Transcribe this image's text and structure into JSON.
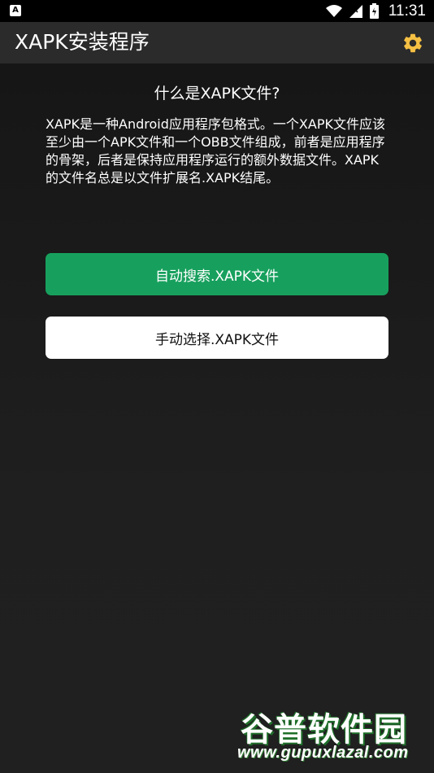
{
  "status_bar": {
    "left_icon": "A",
    "time": "11:31",
    "icons": [
      "wifi-icon",
      "signal-icon",
      "battery-icon"
    ]
  },
  "app_bar": {
    "title": "XAPK安装程序",
    "settings_icon": "gear-icon",
    "accent_color": "#f5c043"
  },
  "main": {
    "heading": "什么是XAPK文件?",
    "description": "XAPK是一种Android应用程序包格式。一个XAPK文件应该至少由一个APK文件和一个OBB文件组成，前者是应用程序的骨架，后者是保持应用程序运行的额外数据文件。XAPK的文件名总是以文件扩展名.XAPK结尾。",
    "auto_button_label": "自动搜索.XAPK文件",
    "manual_button_label": "手动选择.XAPK文件",
    "auto_button_color": "#17a05d"
  },
  "watermark": {
    "name": "谷普软件园",
    "url": "www.gupuxlazal.com"
  }
}
